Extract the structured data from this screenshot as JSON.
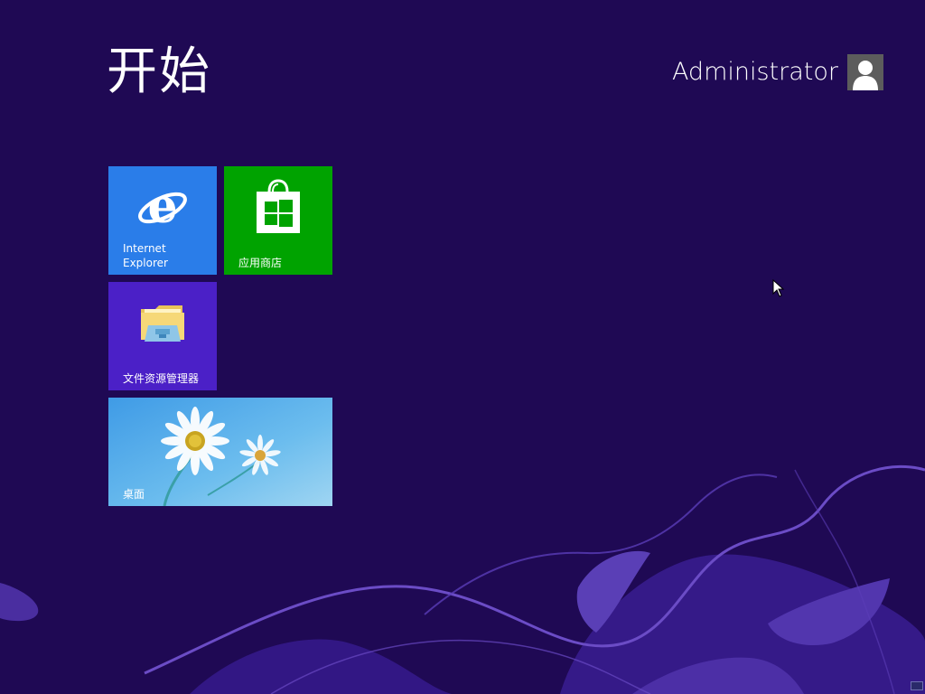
{
  "start": {
    "title": "开始"
  },
  "user": {
    "name": "Administrator",
    "avatar_icon": "user-silhouette-icon"
  },
  "tiles": [
    {
      "id": "ie",
      "label": "Internet\nExplorer",
      "icon": "internet-explorer-icon",
      "color": "#2a7de9"
    },
    {
      "id": "store",
      "label": "应用商店",
      "icon": "windows-store-icon",
      "color": "#00a300"
    },
    {
      "id": "explorer",
      "label": "文件资源管理器",
      "icon": "file-explorer-icon",
      "color": "#4b20c7"
    },
    {
      "id": "desktop",
      "label": "桌面",
      "icon": "desktop-wallpaper-daisy",
      "color": "#5aaee8"
    }
  ],
  "colors": {
    "background": "#1f0954",
    "accent_swirl": "#5b3db8"
  }
}
